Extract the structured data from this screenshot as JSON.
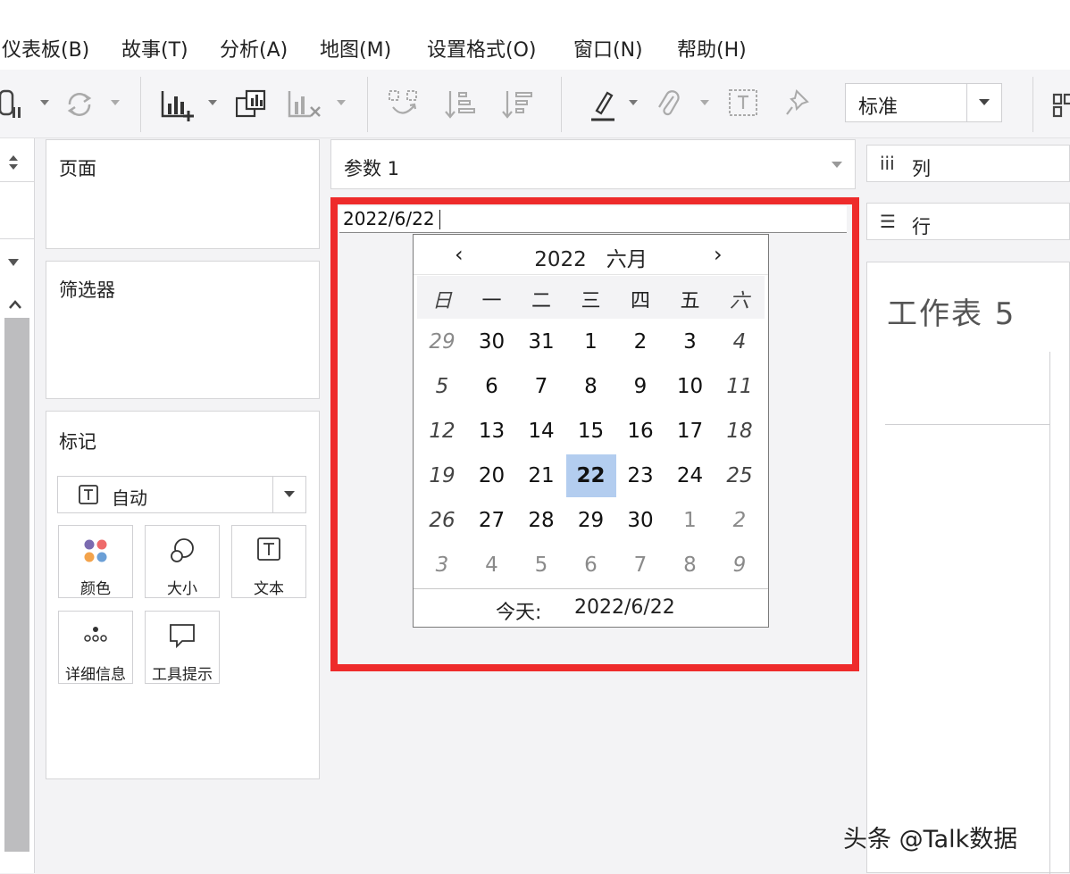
{
  "menu": [
    "仪表板(B)",
    "故事(T)",
    "分析(A)",
    "地图(M)",
    "设置格式(O)",
    "窗口(N)",
    "帮助(H)"
  ],
  "toolbar": {
    "style_select_value": "标准",
    "icons": [
      "datasource-icon",
      "refresh-icon",
      "new-worksheet-icon",
      "duplicate-sheet-icon",
      "clear-sheet-icon",
      "swap-icon",
      "sort-ascending-icon",
      "sort-descending-icon",
      "highlight-icon",
      "group-icon",
      "label-icon",
      "pin-icon",
      "show-me-icon"
    ]
  },
  "pages_card": {
    "title": "页面"
  },
  "filters_card": {
    "title": "筛选器"
  },
  "marks_card": {
    "title": "标记",
    "type_label": "自动",
    "buttons": [
      {
        "label": "颜色",
        "icon": "color-icon"
      },
      {
        "label": "大小",
        "icon": "size-icon"
      },
      {
        "label": "文本",
        "icon": "text-icon"
      },
      {
        "label": "详细信息",
        "icon": "detail-icon"
      },
      {
        "label": "工具提示",
        "icon": "tooltip-icon"
      }
    ]
  },
  "parameter": {
    "title": "参数 1",
    "input_value": "2022/6/22"
  },
  "calendar": {
    "year": "2022",
    "month": "六月",
    "prev": "‹",
    "next": "›",
    "weekdays": [
      "日",
      "一",
      "二",
      "三",
      "四",
      "五",
      "六"
    ],
    "weeks": [
      [
        {
          "d": "29",
          "other": true
        },
        {
          "d": "30",
          "other": false
        },
        {
          "d": "31",
          "other": false
        },
        {
          "d": "1"
        },
        {
          "d": "2"
        },
        {
          "d": "3"
        },
        {
          "d": "4"
        }
      ],
      [
        {
          "d": "5"
        },
        {
          "d": "6"
        },
        {
          "d": "7"
        },
        {
          "d": "8"
        },
        {
          "d": "9"
        },
        {
          "d": "10"
        },
        {
          "d": "11"
        }
      ],
      [
        {
          "d": "12"
        },
        {
          "d": "13"
        },
        {
          "d": "14"
        },
        {
          "d": "15"
        },
        {
          "d": "16"
        },
        {
          "d": "17"
        },
        {
          "d": "18"
        }
      ],
      [
        {
          "d": "19"
        },
        {
          "d": "20"
        },
        {
          "d": "21"
        },
        {
          "d": "22",
          "selected": true
        },
        {
          "d": "23"
        },
        {
          "d": "24"
        },
        {
          "d": "25"
        }
      ],
      [
        {
          "d": "26"
        },
        {
          "d": "27"
        },
        {
          "d": "28"
        },
        {
          "d": "29"
        },
        {
          "d": "30"
        },
        {
          "d": "1",
          "other": true
        },
        {
          "d": "2",
          "other": true
        }
      ],
      [
        {
          "d": "3",
          "other": true
        },
        {
          "d": "4",
          "other": true
        },
        {
          "d": "5",
          "other": true
        },
        {
          "d": "6",
          "other": true
        },
        {
          "d": "7",
          "other": true
        },
        {
          "d": "8",
          "other": true
        },
        {
          "d": "9",
          "other": true
        }
      ]
    ],
    "today_label": "今天:",
    "today_value": "2022/6/22"
  },
  "shelves": {
    "columns_label": "列",
    "rows_label": "行"
  },
  "sheet": {
    "title": "工作表 5"
  },
  "watermark": "头条 @Talk数据",
  "colors": {
    "highlight_border": "#ee2b2b",
    "selected_day": "#b3cdef"
  }
}
